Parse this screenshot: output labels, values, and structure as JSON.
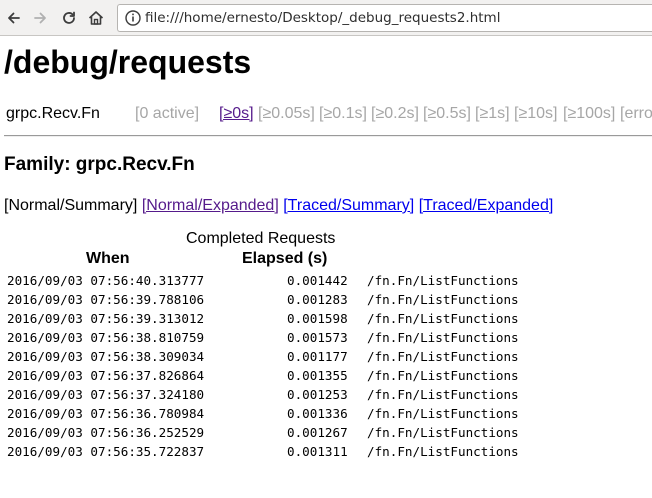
{
  "browser": {
    "url": "file:///home/ernesto/Desktop/_debug_requests2.html"
  },
  "page": {
    "title": "/debug/requests",
    "family_row": {
      "name": "grpc.Recv.Fn",
      "active": "[0 active]",
      "buckets": [
        "[≥0s]",
        "[≥0.05s]",
        "[≥0.1s]",
        "[≥0.2s]",
        "[≥0.5s]",
        "[≥1s]",
        "[≥10s]",
        "[≥100s]",
        "[erro"
      ]
    },
    "family_heading": "Family: grpc.Recv.Fn",
    "views": {
      "current": "[Normal/Summary]",
      "normal_expanded": "[Normal/Expanded]",
      "traced_summary": "[Traced/Summary]",
      "traced_expanded": "[Traced/Expanded]"
    },
    "table": {
      "caption": "Completed Requests",
      "headers": {
        "when": "When",
        "elapsed": "Elapsed (s)"
      },
      "rows": [
        {
          "when": "2016/09/03 07:56:40.313777",
          "elapsed": "0.001442",
          "method": "/fn.Fn/ListFunctions"
        },
        {
          "when": "2016/09/03 07:56:39.788106",
          "elapsed": "0.001283",
          "method": "/fn.Fn/ListFunctions"
        },
        {
          "when": "2016/09/03 07:56:39.313012",
          "elapsed": "0.001598",
          "method": "/fn.Fn/ListFunctions"
        },
        {
          "when": "2016/09/03 07:56:38.810759",
          "elapsed": "0.001573",
          "method": "/fn.Fn/ListFunctions"
        },
        {
          "when": "2016/09/03 07:56:38.309034",
          "elapsed": "0.001177",
          "method": "/fn.Fn/ListFunctions"
        },
        {
          "when": "2016/09/03 07:56:37.826864",
          "elapsed": "0.001355",
          "method": "/fn.Fn/ListFunctions"
        },
        {
          "when": "2016/09/03 07:56:37.324180",
          "elapsed": "0.001253",
          "method": "/fn.Fn/ListFunctions"
        },
        {
          "when": "2016/09/03 07:56:36.780984",
          "elapsed": "0.001336",
          "method": "/fn.Fn/ListFunctions"
        },
        {
          "when": "2016/09/03 07:56:36.252529",
          "elapsed": "0.001267",
          "method": "/fn.Fn/ListFunctions"
        },
        {
          "when": "2016/09/03 07:56:35.722837",
          "elapsed": "0.001311",
          "method": "/fn.Fn/ListFunctions"
        }
      ]
    }
  },
  "icons": {
    "back": "arrow-left-icon",
    "forward": "arrow-right-icon",
    "reload": "reload-icon",
    "home": "home-icon",
    "info": "info-icon"
  },
  "colors": {
    "visited_link": "#551a8b",
    "link": "#0000ee",
    "inactive_bucket": "#a6a6a6"
  }
}
